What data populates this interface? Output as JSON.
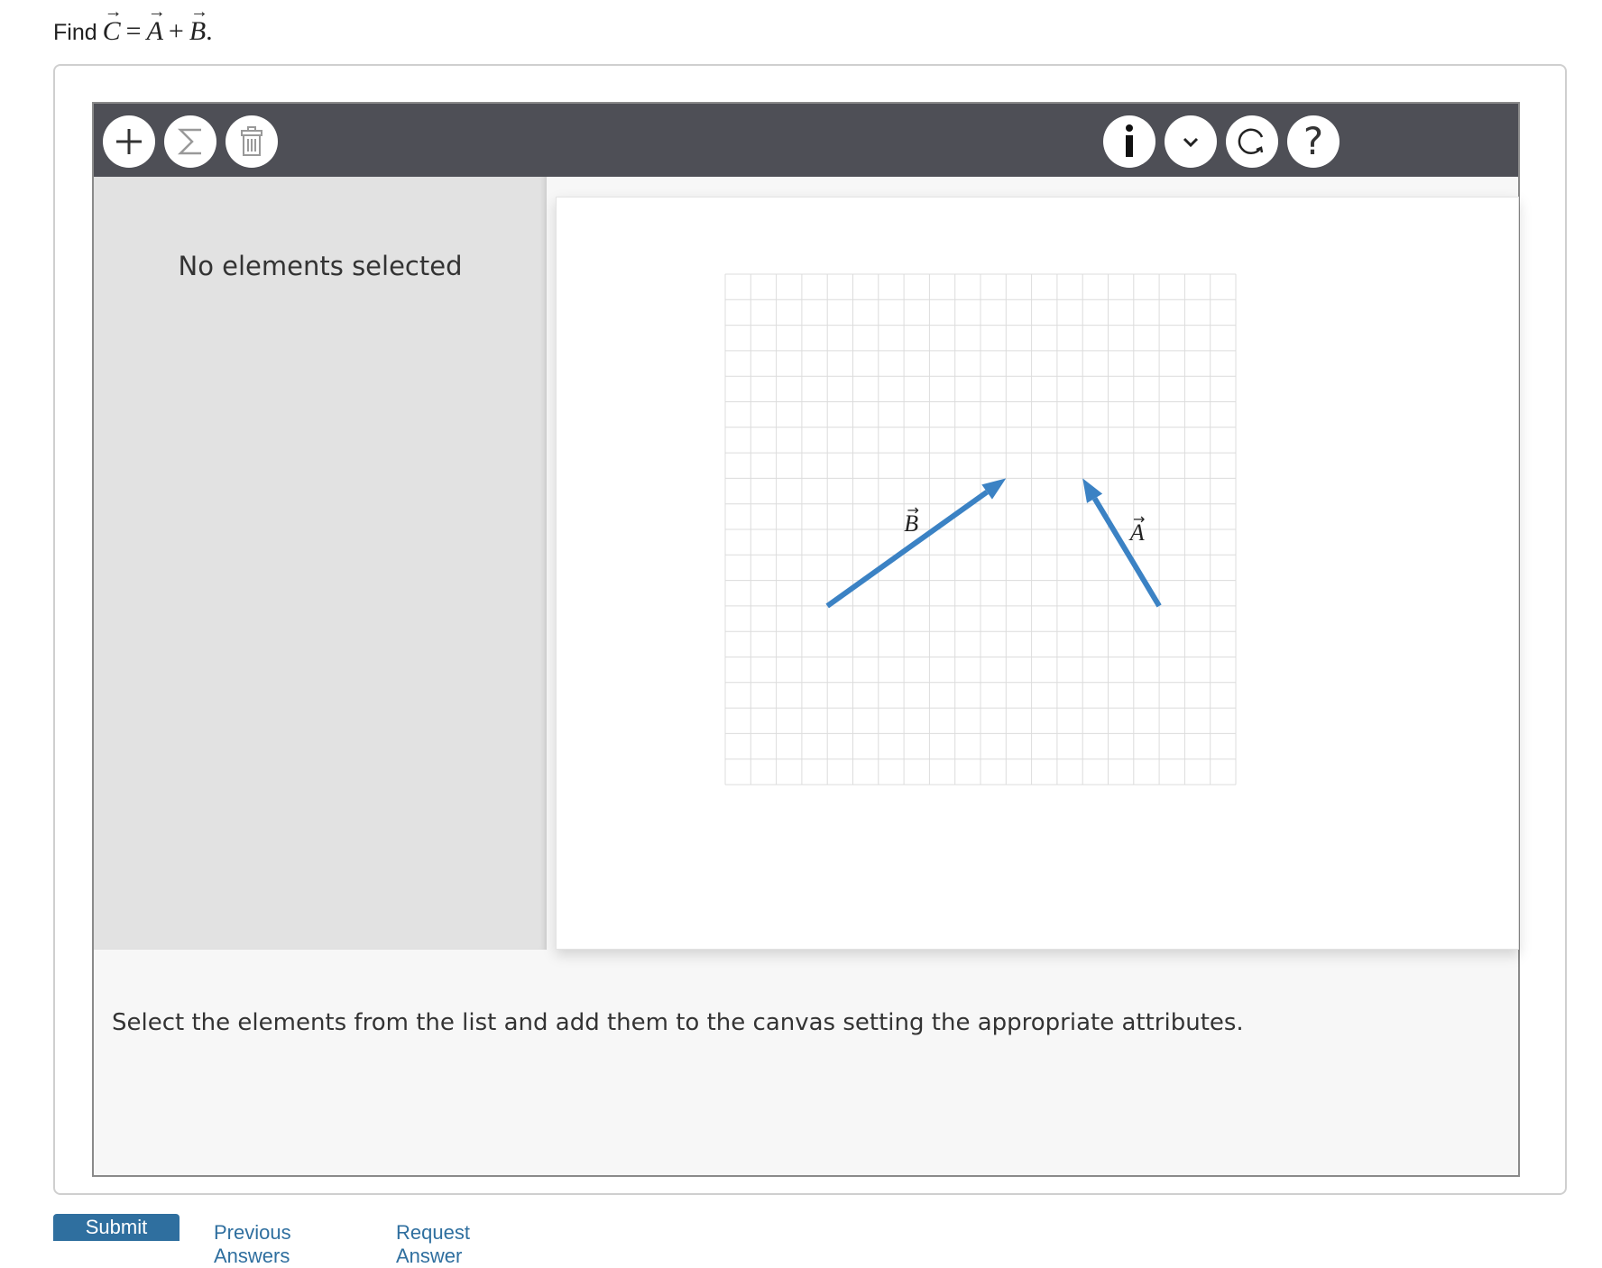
{
  "question": {
    "prefix": "Find",
    "vec_c": "C",
    "equals": "=",
    "vec_a": "A",
    "plus": "+",
    "vec_b": "B",
    "period": "."
  },
  "toolbar": {
    "left_icons": [
      "plus-icon",
      "sigma-icon",
      "trash-icon"
    ],
    "right_icons": [
      "info-icon",
      "chevron-down-icon",
      "reset-icon",
      "help-icon"
    ],
    "help_glyph": "?"
  },
  "left_panel": {
    "status": "No elements selected"
  },
  "canvas": {
    "grid_cells": 20,
    "vectors": [
      {
        "label": "A",
        "tail": [
          17,
          7
        ],
        "head": [
          14,
          12
        ],
        "color": "#3b82c4"
      },
      {
        "label": "B",
        "tail": [
          4,
          7
        ],
        "head": [
          11,
          12
        ],
        "color": "#3b82c4"
      }
    ],
    "arrow_glyph": "→"
  },
  "instructions": "Select the elements from the list and add them to the canvas setting the appropriate attributes.",
  "footer": {
    "submit_label": "Submit",
    "previous_label": "Previous Answers",
    "request_label": "Request Answer"
  }
}
